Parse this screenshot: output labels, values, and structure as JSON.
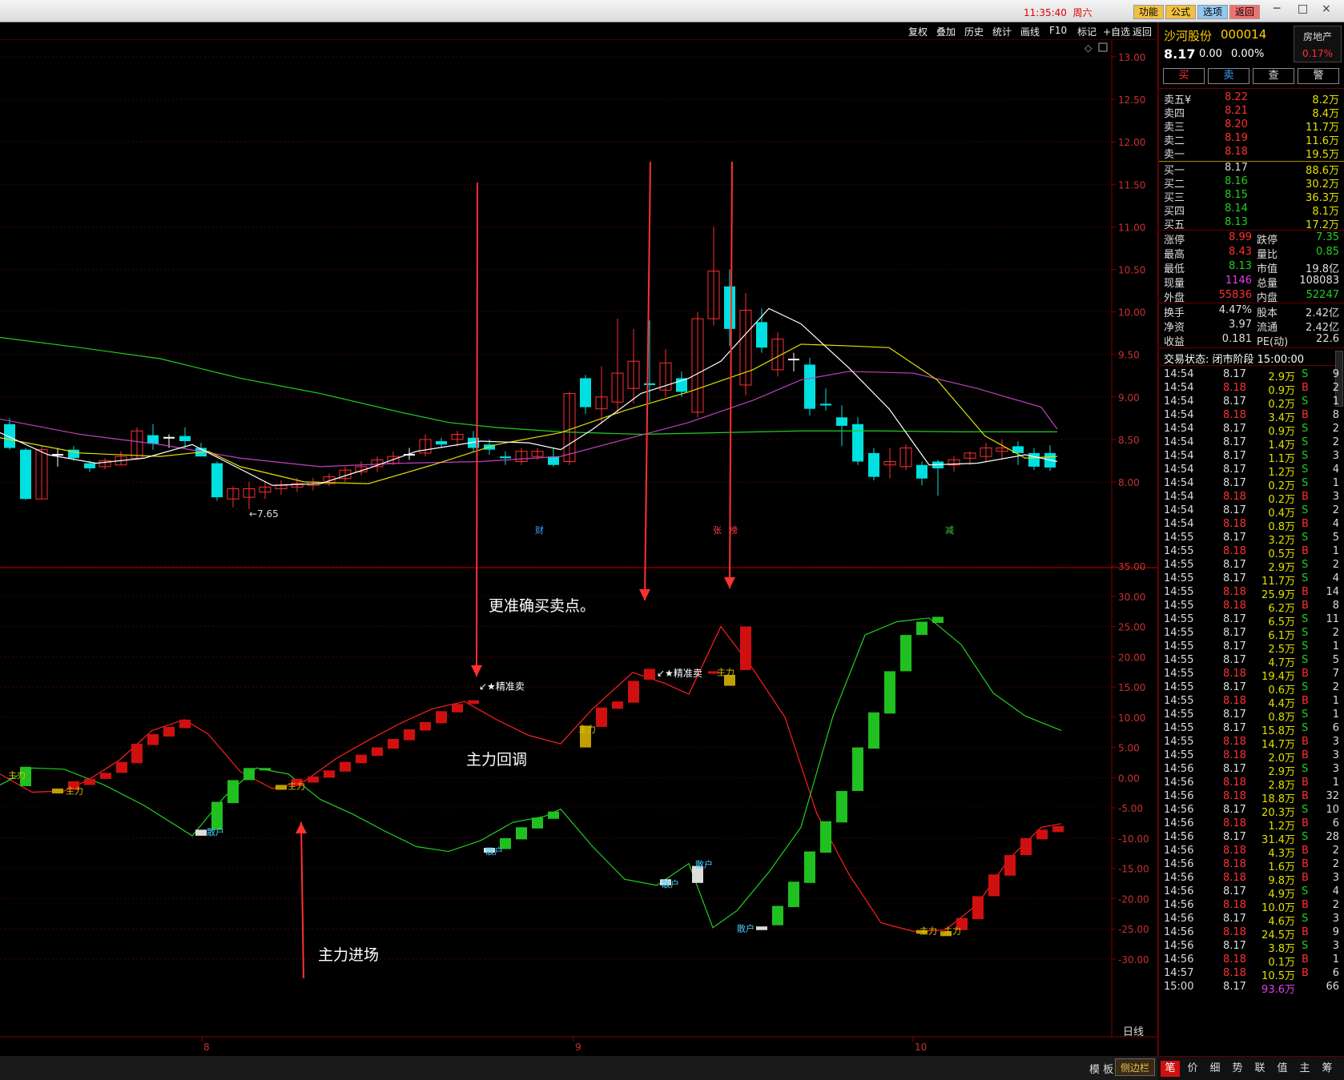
{
  "topbar": {
    "time": "11:35:40",
    "weekday": "周六",
    "buttons": [
      "功能",
      "公式",
      "选项",
      "返回"
    ],
    "win_min": "─",
    "win_max": "□",
    "win_close": "×"
  },
  "toolbar": {
    "items": [
      "复权",
      "叠加",
      "历史",
      "统计",
      "画线",
      "F10",
      "标记",
      "+自选",
      "返回"
    ]
  },
  "chart": {
    "price_axis": [
      "13.00",
      "12.50",
      "12.00",
      "11.50",
      "11.00",
      "10.50",
      "10.00",
      "9.50",
      "9.00",
      "8.50",
      "8.00"
    ],
    "indicator_axis": [
      "35.00",
      "30.00",
      "25.00",
      "20.00",
      "15.00",
      "10.00",
      "5.00",
      "0.00",
      "-5.00",
      "-10.00",
      "-15.00",
      "-20.00",
      "-25.00",
      "-30.00"
    ],
    "low_marker": "←7.65",
    "event_markers": [
      "财",
      "张",
      "榜",
      "减"
    ],
    "signal_labels": [
      "↙★精准卖",
      "↙★精准卖"
    ],
    "tag_zhuli": "主力",
    "tag_sanhu": "散户",
    "month_labels": [
      "8",
      "9",
      "10"
    ],
    "period": "日线",
    "notes": {
      "buy_sell": "更准确买卖点。",
      "pullback": "主力回调",
      "entry": "主力进场"
    }
  },
  "bottom": {
    "template": "模 板",
    "plus": "+",
    "minus": "−",
    "sidebar": "侧边栏"
  },
  "quote": {
    "name": "沙河股份",
    "code": "000014",
    "sector": "房地产",
    "sector_change": "0.17%",
    "price": "8.17",
    "change": "0.00",
    "change_pct": "0.00%",
    "action_buttons": [
      "买",
      "卖",
      "查",
      "警"
    ],
    "asks": [
      {
        "label": "卖五¥",
        "price": "8.22",
        "vol": "8.2万"
      },
      {
        "label": "卖四",
        "price": "8.21",
        "vol": "8.4万"
      },
      {
        "label": "卖三",
        "price": "8.20",
        "vol": "11.7万"
      },
      {
        "label": "卖二",
        "price": "8.19",
        "vol": "11.6万"
      },
      {
        "label": "卖一",
        "price": "8.18",
        "vol": "19.5万"
      }
    ],
    "bids": [
      {
        "label": "买一",
        "price": "8.17",
        "vol": "88.6万"
      },
      {
        "label": "买二",
        "price": "8.16",
        "vol": "30.2万"
      },
      {
        "label": "买三",
        "price": "8.15",
        "vol": "36.3万"
      },
      {
        "label": "买四",
        "price": "8.14",
        "vol": "8.1万"
      },
      {
        "label": "买五",
        "price": "8.13",
        "vol": "17.2万"
      }
    ],
    "stats": [
      {
        "l1": "涨停",
        "v1": "8.99",
        "c1": "#ff3030",
        "l2": "跌停",
        "v2": "7.35",
        "c2": "#20d020"
      },
      {
        "l1": "最高",
        "v1": "8.43",
        "c1": "#ff3030",
        "l2": "量比",
        "v2": "0.85",
        "c2": "#20d020"
      },
      {
        "l1": "最低",
        "v1": "8.13",
        "c1": "#20d020",
        "l2": "市值",
        "v2": "19.8亿",
        "c2": "#e0e0e0"
      },
      {
        "l1": "现量",
        "v1": "1146",
        "c1": "#e040e0",
        "l2": "总量",
        "v2": "108083",
        "c2": "#e0e0e0"
      },
      {
        "l1": "外盘",
        "v1": "55836",
        "c1": "#ff3030",
        "l2": "内盘",
        "v2": "52247",
        "c2": "#20d020"
      }
    ],
    "stats2": [
      {
        "l1": "换手",
        "v1": "4.47%",
        "l2": "股本",
        "v2": "2.42亿"
      },
      {
        "l1": "净资",
        "v1": "3.97",
        "l2": "流通",
        "v2": "2.42亿"
      },
      {
        "l1": "收益",
        "v1": "0.181",
        "l2": "PE(动)",
        "v2": "22.6"
      }
    ],
    "trade_status": "交易状态: 闭市阶段 15:00:00"
  },
  "ticks": [
    [
      "14:54",
      "8.17",
      "2.9万",
      "S",
      "9"
    ],
    [
      "14:54",
      "8.18",
      "0.9万",
      "B",
      "2"
    ],
    [
      "14:54",
      "8.17",
      "0.2万",
      "S",
      "1"
    ],
    [
      "14:54",
      "8.18",
      "3.4万",
      "B",
      "8"
    ],
    [
      "14:54",
      "8.17",
      "0.9万",
      "S",
      "2"
    ],
    [
      "14:54",
      "8.17",
      "1.4万",
      "S",
      "2"
    ],
    [
      "14:54",
      "8.17",
      "1.1万",
      "S",
      "3"
    ],
    [
      "14:54",
      "8.17",
      "1.2万",
      "S",
      "4"
    ],
    [
      "14:54",
      "8.17",
      "0.2万",
      "S",
      "1"
    ],
    [
      "14:54",
      "8.18",
      "0.2万",
      "B",
      "3"
    ],
    [
      "14:54",
      "8.17",
      "0.4万",
      "S",
      "2"
    ],
    [
      "14:54",
      "8.18",
      "0.8万",
      "B",
      "4"
    ],
    [
      "14:55",
      "8.17",
      "3.2万",
      "S",
      "5"
    ],
    [
      "14:55",
      "8.18",
      "0.5万",
      "B",
      "1"
    ],
    [
      "14:55",
      "8.17",
      "2.9万",
      "S",
      "2"
    ],
    [
      "14:55",
      "8.17",
      "11.7万",
      "S",
      "4"
    ],
    [
      "14:55",
      "8.18",
      "25.9万",
      "B",
      "14"
    ],
    [
      "14:55",
      "8.18",
      "6.2万",
      "B",
      "8"
    ],
    [
      "14:55",
      "8.17",
      "6.5万",
      "S",
      "11"
    ],
    [
      "14:55",
      "8.17",
      "6.1万",
      "S",
      "2"
    ],
    [
      "14:55",
      "8.17",
      "2.5万",
      "S",
      "1"
    ],
    [
      "14:55",
      "8.17",
      "4.7万",
      "S",
      "5"
    ],
    [
      "14:55",
      "8.18",
      "19.4万",
      "B",
      "7"
    ],
    [
      "14:55",
      "8.17",
      "0.6万",
      "S",
      "2"
    ],
    [
      "14:55",
      "8.18",
      "4.4万",
      "B",
      "1"
    ],
    [
      "14:55",
      "8.17",
      "0.8万",
      "S",
      "1"
    ],
    [
      "14:55",
      "8.17",
      "15.8万",
      "S",
      "6"
    ],
    [
      "14:55",
      "8.18",
      "14.7万",
      "B",
      "3"
    ],
    [
      "14:55",
      "8.18",
      "2.0万",
      "B",
      "3"
    ],
    [
      "14:56",
      "8.17",
      "2.9万",
      "S",
      "3"
    ],
    [
      "14:56",
      "8.18",
      "2.8万",
      "B",
      "1"
    ],
    [
      "14:56",
      "8.18",
      "18.8万",
      "B",
      "32"
    ],
    [
      "14:56",
      "8.17",
      "20.3万",
      "S",
      "10"
    ],
    [
      "14:56",
      "8.18",
      "1.2万",
      "B",
      "6"
    ],
    [
      "14:56",
      "8.17",
      "31.4万",
      "S",
      "28"
    ],
    [
      "14:56",
      "8.18",
      "4.3万",
      "B",
      "2"
    ],
    [
      "14:56",
      "8.18",
      "1.6万",
      "B",
      "2"
    ],
    [
      "14:56",
      "8.18",
      "9.8万",
      "B",
      "3"
    ],
    [
      "14:56",
      "8.17",
      "4.9万",
      "S",
      "4"
    ],
    [
      "14:56",
      "8.18",
      "10.0万",
      "B",
      "2"
    ],
    [
      "14:56",
      "8.17",
      "4.6万",
      "S",
      "3"
    ],
    [
      "14:56",
      "8.18",
      "24.5万",
      "B",
      "9"
    ],
    [
      "14:56",
      "8.17",
      "3.8万",
      "S",
      "3"
    ],
    [
      "14:56",
      "8.18",
      "0.1万",
      "B",
      "1"
    ],
    [
      "14:57",
      "8.18",
      "10.5万",
      "B",
      "6"
    ],
    [
      "15:00",
      "8.17",
      "93.6万",
      "",
      "66"
    ]
  ],
  "bottom_tabs": [
    "笔",
    "价",
    "细",
    "势",
    "联",
    "值",
    "主",
    "筹"
  ],
  "colors": {
    "up": "#ff3030",
    "down": "#00e0e0",
    "green": "#20d020",
    "yellow": "#e0e000",
    "white": "#ffffff",
    "magenta": "#c040c0",
    "grid": "#800000"
  }
}
